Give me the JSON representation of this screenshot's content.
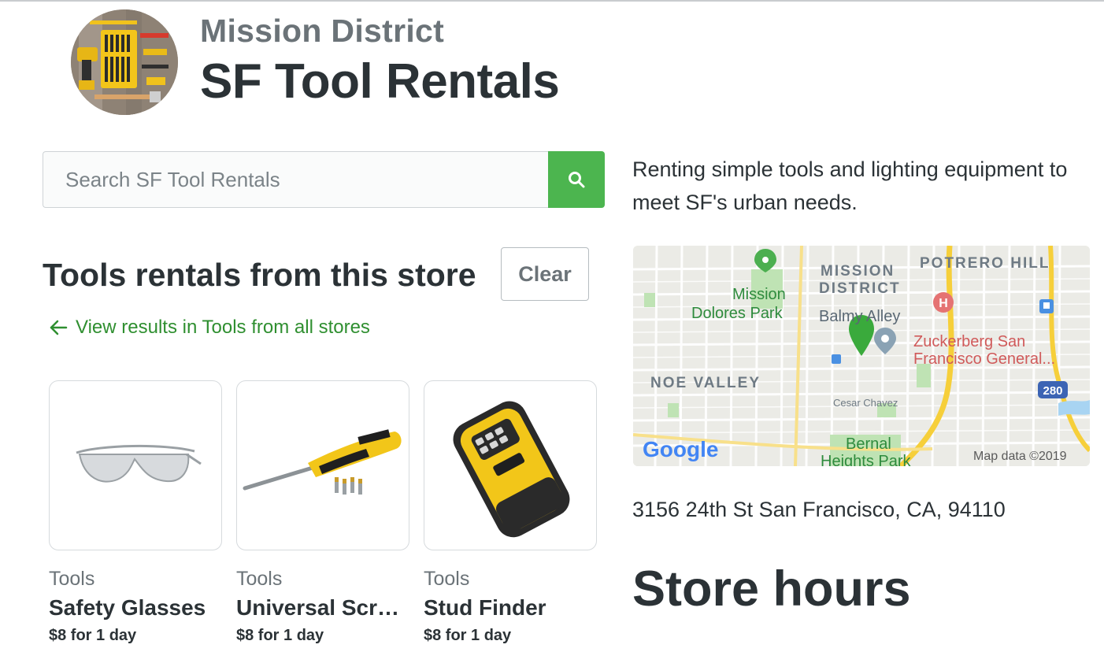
{
  "store": {
    "neighborhood": "Mission District",
    "name": "SF Tool Rentals",
    "description": "Renting simple tools and lighting equipment to meet SF's urban needs.",
    "address": "3156 24th St San Francisco, CA, 94110"
  },
  "search": {
    "placeholder": "Search SF Tool Rentals"
  },
  "listing": {
    "title": "Tools rentals from this store",
    "clear_label": "Clear",
    "view_all_label": "View results in Tools from all stores"
  },
  "products": [
    {
      "category": "Tools",
      "name": "Safety Glasses",
      "price": "$8 for 1 day"
    },
    {
      "category": "Tools",
      "name": "Universal Screwdriver",
      "price": "$8 for 1 day"
    },
    {
      "category": "Tools",
      "name": "Stud Finder",
      "price": "$8 for 1 day"
    }
  ],
  "map": {
    "labels": {
      "mission_district_1": "MISSION",
      "mission_district_2": "DISTRICT",
      "potrero_hill": "POTRERO HILL",
      "dolores_1": "Mission",
      "dolores_2": "Dolores Park",
      "balmy": "Balmy Alley",
      "zuckerberg_1": "Zuckerberg San",
      "zuckerberg_2": "Francisco General...",
      "noe_valley": "NOE VALLEY",
      "cesar_chavez": "Cesar Chavez",
      "bernal_1": "Bernal",
      "bernal_2": "Heights Park",
      "highway": "280",
      "attribution": "Map data ©2019",
      "google": "Google"
    }
  },
  "hours": {
    "title": "Store hours"
  },
  "colors": {
    "accent": "#4cb54f",
    "link": "#2f8f30",
    "text": "#2b3236",
    "muted": "#6b7378"
  },
  "icons": {
    "search": "search-icon",
    "back": "arrow-left-icon",
    "pin": "map-pin-icon"
  }
}
